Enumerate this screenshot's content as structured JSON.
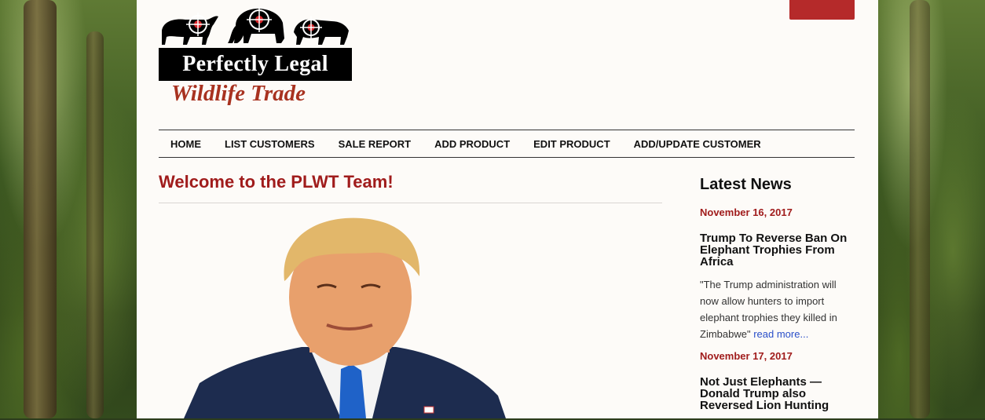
{
  "logo": {
    "title": "Perfectly Legal",
    "subtitle": "Wildlife Trade"
  },
  "nav": {
    "items": [
      "HOME",
      "LIST CUSTOMERS",
      "SALE REPORT",
      "ADD PRODUCT",
      "EDIT PRODUCT",
      "ADD/UPDATE CUSTOMER"
    ]
  },
  "main": {
    "heading": "Welcome to the PLWT Team!"
  },
  "sidebar": {
    "title": "Latest News",
    "news": [
      {
        "date": "November 16, 2017",
        "headline": "Trump To Reverse Ban On Elephant Trophies From Africa",
        "excerpt": "\"The Trump administration will now allow hunters to import elephant trophies they killed in Zimbabwe\"",
        "more": "read more..."
      },
      {
        "date": "November 17, 2017",
        "headline": "Not Just Elephants — Donald Trump also Reversed Lion Hunting"
      }
    ]
  },
  "colors": {
    "accent": "#a01c1c",
    "topbar": "#b52a2a",
    "link": "#2a4fc9"
  }
}
